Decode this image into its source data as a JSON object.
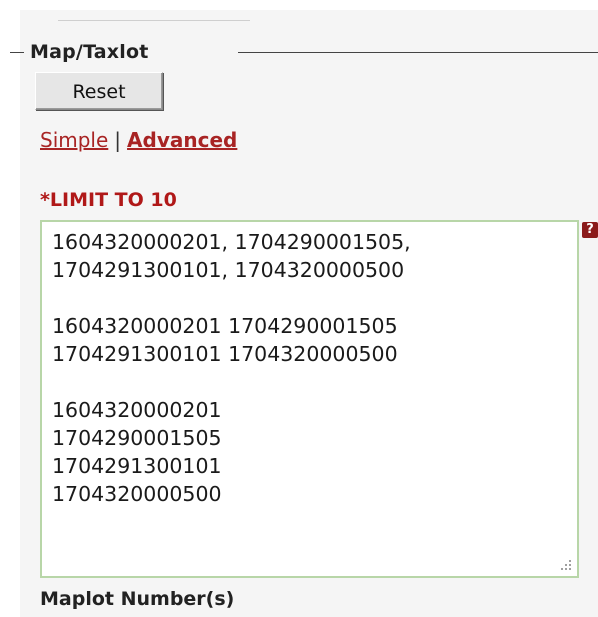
{
  "section": {
    "title": "Map/Taxlot"
  },
  "buttons": {
    "reset_label": "Reset"
  },
  "mode": {
    "simple_label": "Simple",
    "separator": "|",
    "advanced_label": "Advanced"
  },
  "limit_label": "*LIMIT TO 10",
  "textarea": {
    "lines": [
      "1604320000201, 1704290001505,",
      "1704291300101, 1704320000500",
      "",
      "1604320000201 1704290001505",
      "1704291300101 1704320000500",
      "",
      "1604320000201",
      "1704290001505",
      "1704291300101",
      "1704320000500"
    ]
  },
  "help_icon": {
    "glyph": "?",
    "name": "help-icon"
  },
  "field_label": "Maplot Number(s)",
  "colors": {
    "link_red": "#a82424",
    "limit_red": "#b01818",
    "textarea_border": "#b8d6a8",
    "help_bg": "#8b1a1a"
  }
}
